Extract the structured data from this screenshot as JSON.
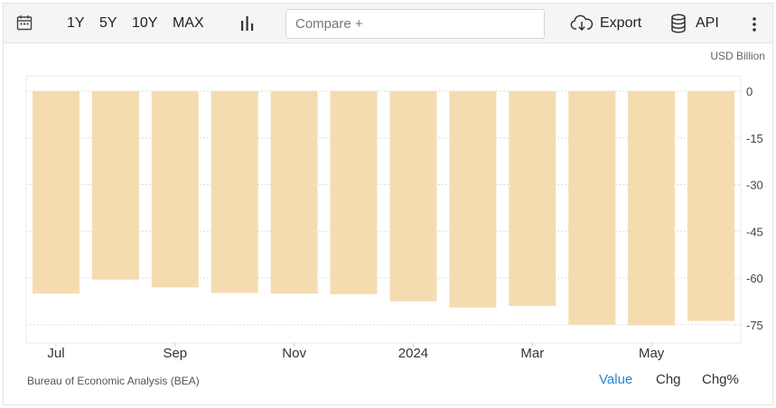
{
  "toolbar": {
    "range_buttons": [
      "1Y",
      "5Y",
      "10Y",
      "MAX"
    ],
    "compare_placeholder": "Compare +",
    "export_label": "Export",
    "api_label": "API"
  },
  "unit_label": "USD Billion",
  "source": "Bureau of Economic Analysis (BEA)",
  "modes": [
    "Value",
    "Chg",
    "Chg%"
  ],
  "active_mode": "Value",
  "colors": {
    "bar": "#f5dcb0",
    "active_mode": "#2a86d1",
    "grid": "#dedede"
  },
  "chart_data": {
    "type": "bar",
    "categories": [
      "2023-07",
      "2023-08",
      "2023-09",
      "2023-10",
      "2023-11",
      "2023-12",
      "2024-01",
      "2024-02",
      "2024-03",
      "2024-04",
      "2024-05",
      "2024-06"
    ],
    "values": [
      -65.0,
      -60.5,
      -63.0,
      -64.8,
      -65.0,
      -65.2,
      -67.5,
      -69.5,
      -69.0,
      -75.0,
      -75.2,
      -73.8
    ],
    "x_tick_labels": [
      {
        "index": 0,
        "label": "Jul"
      },
      {
        "index": 2,
        "label": "Sep"
      },
      {
        "index": 4,
        "label": "Nov"
      },
      {
        "index": 6,
        "label": "2024"
      },
      {
        "index": 8,
        "label": "Mar"
      },
      {
        "index": 10,
        "label": "May"
      }
    ],
    "y_ticks": [
      0,
      -15,
      -30,
      -45,
      -60,
      -75
    ],
    "ylim": [
      -80,
      0
    ],
    "grid": true,
    "y_axis_position": "right"
  }
}
